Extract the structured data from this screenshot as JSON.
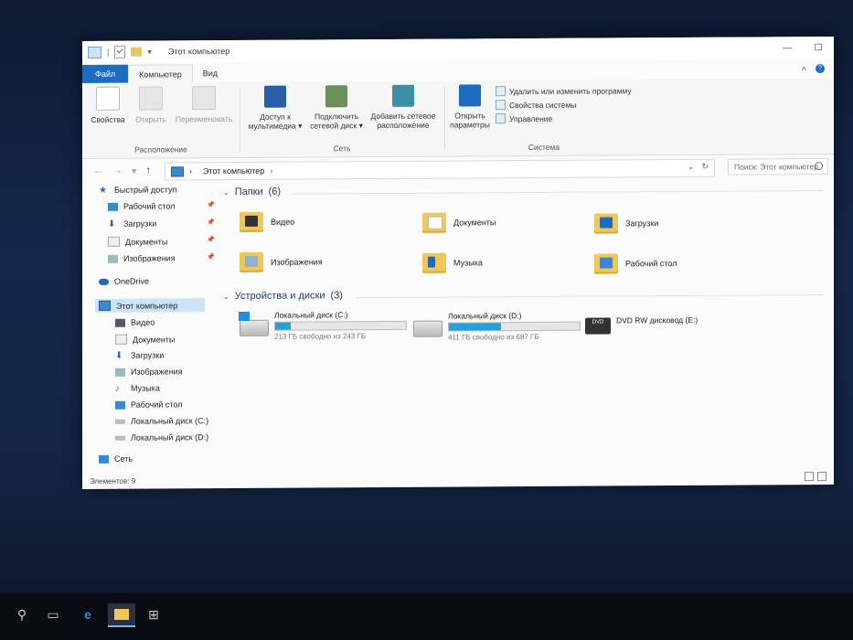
{
  "window": {
    "title": "Этот компьютер",
    "controls": {
      "minimize": "—",
      "maximize": "☐"
    }
  },
  "ribbon_tabs": {
    "file": "Файл",
    "computer": "Компьютер",
    "view": "Вид",
    "collapse": "˄",
    "help": "?"
  },
  "ribbon": {
    "location_group": {
      "label": "Расположение",
      "properties": "Свойства",
      "open": "Открыть",
      "rename": "Переименовать"
    },
    "network_group": {
      "label": "Сеть",
      "media_access": "Доступ к мультимедиа",
      "map_drive": "Подключить сетевой диск",
      "add_location": "Добавить сетевое расположение"
    },
    "system_group": {
      "label": "Система",
      "open_settings": "Открыть параметры",
      "uninstall": "Удалить или изменить программу",
      "system_properties": "Свойства системы",
      "manage": "Управление"
    }
  },
  "address": {
    "path": "Этот компьютер",
    "search_placeholder": "Поиск: Этот компьютер"
  },
  "nav": {
    "quick_access": "Быстрый доступ",
    "quick_items": [
      "Рабочий стол",
      "Загрузки",
      "Документы",
      "Изображения"
    ],
    "onedrive": "OneDrive",
    "this_pc": "Этот компьютер",
    "pc_items": [
      "Видео",
      "Документы",
      "Загрузки",
      "Изображения",
      "Музыка",
      "Рабочий стол",
      "Локальный диск (C:)",
      "Локальный диск (D:)"
    ],
    "network": "Сеть"
  },
  "folders_section": {
    "title": "Папки",
    "count": "(6)"
  },
  "folders": [
    "Видео",
    "Документы",
    "Загрузки",
    "Изображения",
    "Музыка",
    "Рабочий стол"
  ],
  "drives_section": {
    "title": "Устройства и диски",
    "count": "(3)"
  },
  "drives": [
    {
      "name": "Локальный диск (C:)",
      "free": "213 ГБ свободно из 243 ГБ",
      "used_fraction": 0.12
    },
    {
      "name": "Локальный диск (D:)",
      "free": "411 ГБ свободно из 687 ГБ",
      "used_fraction": 0.4
    },
    {
      "name": "DVD RW дисковод (E:)"
    }
  ],
  "status": {
    "items": "Элементов: 9"
  },
  "colors": {
    "accent": "#1c6cc2",
    "drive_bar": "#26a0da",
    "folder": "#f0c85a"
  }
}
